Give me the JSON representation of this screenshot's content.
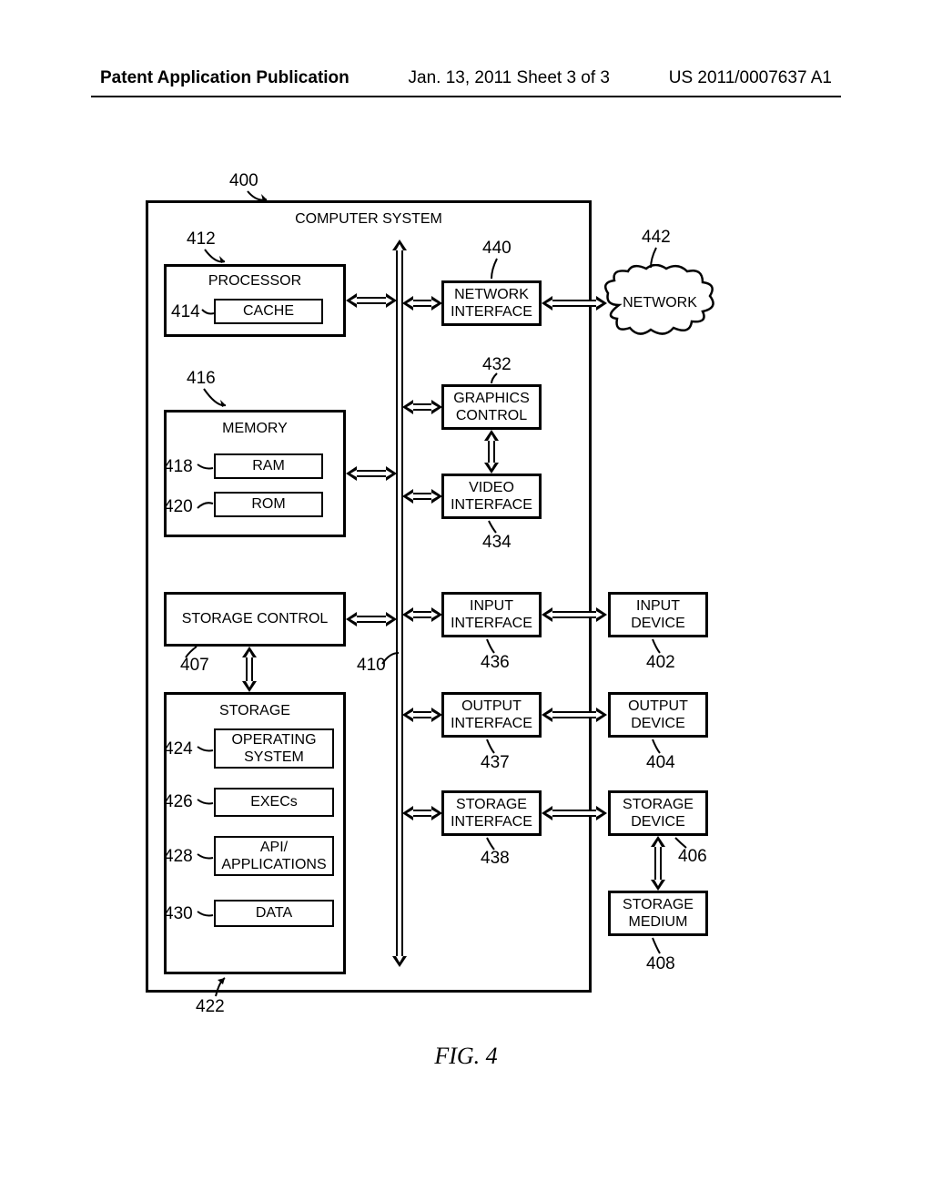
{
  "header": {
    "left": "Patent Application Publication",
    "center": "Jan. 13, 2011  Sheet 3 of 3",
    "right": "US 2011/0007637 A1"
  },
  "figure_label": "FIG. 4",
  "diagram": {
    "title": "COMPUTER SYSTEM",
    "system_ref": "400",
    "bus_ref": "410",
    "blocks": {
      "processor": {
        "label": "PROCESSOR",
        "ref": "412"
      },
      "cache": {
        "label": "CACHE",
        "ref": "414"
      },
      "memory": {
        "label": "MEMORY",
        "ref": "416"
      },
      "ram": {
        "label": "RAM",
        "ref": "418"
      },
      "rom": {
        "label": "ROM",
        "ref": "420"
      },
      "storage_control": {
        "label": "STORAGE CONTROL",
        "ref": "407"
      },
      "storage": {
        "label": "STORAGE",
        "ref": "422"
      },
      "operating_system": {
        "label": "OPERATING SYSTEM",
        "ref": "424"
      },
      "execs": {
        "label": "EXECs",
        "ref": "426"
      },
      "api_applications": {
        "label": "API/ APPLICATIONS",
        "ref": "428"
      },
      "data": {
        "label": "DATA",
        "ref": "430"
      },
      "network_interface": {
        "label": "NETWORK INTERFACE",
        "ref": "440"
      },
      "graphics_control": {
        "label": "GRAPHICS CONTROL",
        "ref": "432"
      },
      "video_interface": {
        "label": "VIDEO INTERFACE",
        "ref": "434"
      },
      "input_interface": {
        "label": "INPUT INTERFACE",
        "ref": "436"
      },
      "output_interface": {
        "label": "OUTPUT INTERFACE",
        "ref": "437"
      },
      "storage_interface": {
        "label": "STORAGE INTERFACE",
        "ref": "438"
      },
      "network": {
        "label": "NETWORK",
        "ref": "442"
      },
      "input_device": {
        "label": "INPUT DEVICE",
        "ref": "402"
      },
      "output_device": {
        "label": "OUTPUT DEVICE",
        "ref": "404"
      },
      "storage_device": {
        "label": "STORAGE DEVICE",
        "ref": "406"
      },
      "storage_medium": {
        "label": "STORAGE MEDIUM",
        "ref": "408"
      }
    }
  }
}
